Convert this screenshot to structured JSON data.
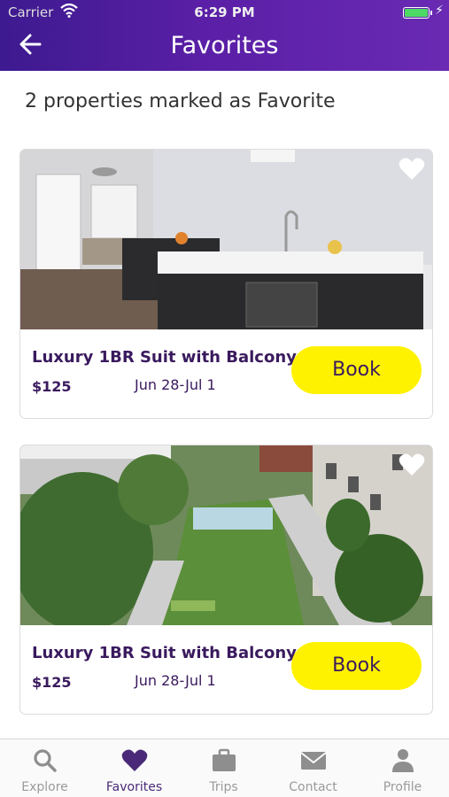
{
  "status_bar": {
    "carrier": "Carrier",
    "time": "6:29 PM"
  },
  "header": {
    "title": "Favorites"
  },
  "summary": "2 properties marked as Favorite",
  "cards": [
    {
      "name": "Luxury 1BR Suit with Balcony",
      "price": "$125",
      "dates": "Jun 28-Jul 1",
      "book_label": "Book"
    },
    {
      "name": "Luxury 1BR Suit with Balcony",
      "price": "$125",
      "dates": "Jun 28-Jul 1",
      "book_label": "Book"
    }
  ],
  "tabs": [
    {
      "label": "Explore",
      "icon": "search-icon"
    },
    {
      "label": "Favorites",
      "icon": "heart-icon",
      "active": true
    },
    {
      "label": "Trips",
      "icon": "briefcase-icon"
    },
    {
      "label": "Contact",
      "icon": "mail-icon"
    },
    {
      "label": "Profile",
      "icon": "person-icon"
    }
  ],
  "colors": {
    "header": "#4b1d9c",
    "book_button": "#fff200",
    "text_accent": "#3a1a5e",
    "active_tab": "#4a2a78"
  }
}
